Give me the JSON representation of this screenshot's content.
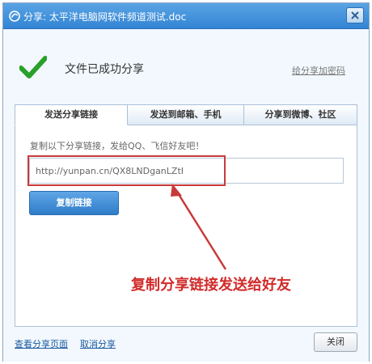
{
  "window": {
    "title": "分享: 太平洋电脑网软件频道测试.doc",
    "close_icon": "close-icon"
  },
  "status": {
    "message": "文件已成功分享",
    "password_link": "给分享加密码"
  },
  "tabs": [
    {
      "label": "发送分享链接",
      "active": true
    },
    {
      "label": "发送到邮箱、手机",
      "active": false
    },
    {
      "label": "分享到微博、社区",
      "active": false
    }
  ],
  "panel": {
    "hint": "复制以下分享链接，发给QQ、飞信好友吧！",
    "link_value": "http://yunpan.cn/QX8LNDganLZtI",
    "copy_label": "复制链接"
  },
  "annotation": {
    "text": "复制分享链接发送给好友",
    "color": "#d12b2b"
  },
  "footer": {
    "view_label": "查看分享页面",
    "cancel_label": "取消分享",
    "close_label": "关闭"
  },
  "colors": {
    "titlebar": "#3384d4",
    "accent": "#2f7cc8",
    "success": "#29a02a"
  }
}
